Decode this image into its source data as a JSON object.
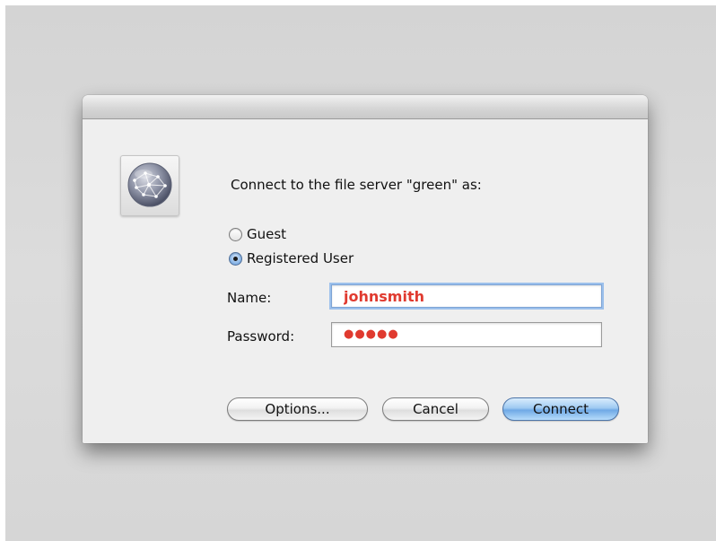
{
  "dialog": {
    "message": "Connect to the file server \"green\" as:",
    "icon": "network-globe-icon"
  },
  "connect_as": {
    "options": [
      {
        "label": "Guest",
        "selected": false
      },
      {
        "label": "Registered User",
        "selected": true
      }
    ]
  },
  "fields": {
    "name_label": "Name:",
    "name_value": "johnsmith",
    "password_label": "Password:",
    "password_mask": "●●●●●"
  },
  "buttons": {
    "options_label": "Options...",
    "cancel_label": "Cancel",
    "connect_label": "Connect"
  },
  "colors": {
    "field_text": "#e03a2f",
    "default_button": "#6fa9e6",
    "focus_ring": "#9cc0ec"
  }
}
